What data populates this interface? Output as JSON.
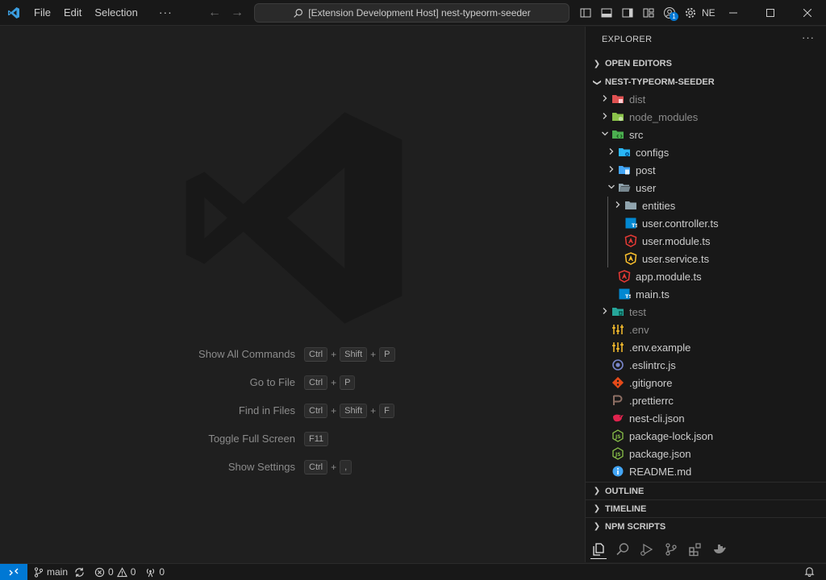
{
  "titlebar": {
    "menu": [
      "File",
      "Edit",
      "Selection"
    ],
    "more": "···",
    "command_center": "[Extension Development Host] nest-typeorm-seeder",
    "account_label": "NE",
    "account_badge": "1"
  },
  "shortcuts": [
    {
      "label": "Show All Commands",
      "keys": [
        "Ctrl",
        "Shift",
        "P"
      ]
    },
    {
      "label": "Go to File",
      "keys": [
        "Ctrl",
        "P"
      ]
    },
    {
      "label": "Find in Files",
      "keys": [
        "Ctrl",
        "Shift",
        "F"
      ]
    },
    {
      "label": "Toggle Full Screen",
      "keys": [
        "F11"
      ]
    },
    {
      "label": "Show Settings",
      "keys": [
        "Ctrl",
        ","
      ]
    }
  ],
  "explorer": {
    "title": "EXPLORER",
    "more": "···",
    "open_editors": "OPEN EDITORS",
    "project": "NEST-TYPEORM-SEEDER",
    "tree": [
      {
        "name": "dist",
        "depth": 0,
        "twist": "›",
        "icon": "folder-dist-icon",
        "color": "#e05252",
        "dim": true
      },
      {
        "name": "node_modules",
        "depth": 0,
        "twist": "›",
        "icon": "folder-node-icon",
        "color": "#8bc34a",
        "dim": true
      },
      {
        "name": "src",
        "depth": 0,
        "twist": "⌄",
        "icon": "folder-src-icon",
        "color": "#4caf50",
        "dim": false
      },
      {
        "name": "configs",
        "depth": 1,
        "twist": "›",
        "icon": "folder-config-icon",
        "color": "#29b6f6",
        "dim": false
      },
      {
        "name": "post",
        "depth": 1,
        "twist": "›",
        "icon": "folder-post-icon",
        "color": "#42a5f5",
        "dim": false
      },
      {
        "name": "user",
        "depth": 1,
        "twist": "⌄",
        "icon": "folder-open-icon",
        "color": "#90a4ae",
        "dim": false
      },
      {
        "name": "entities",
        "depth": 2,
        "twist": "›",
        "icon": "folder-icon",
        "color": "#90a4ae",
        "dim": false
      },
      {
        "name": "user.controller.ts",
        "depth": 2,
        "twist": "",
        "icon": "typescript-icon",
        "color": "#0288d1",
        "dim": false
      },
      {
        "name": "user.module.ts",
        "depth": 2,
        "twist": "",
        "icon": "angular-module-icon",
        "color": "#e53935",
        "dim": false
      },
      {
        "name": "user.service.ts",
        "depth": 2,
        "twist": "",
        "icon": "angular-service-icon",
        "color": "#fbc02d",
        "dim": false
      },
      {
        "name": "app.module.ts",
        "depth": 1,
        "twist": "",
        "icon": "angular-module-icon",
        "color": "#e53935",
        "dim": false
      },
      {
        "name": "main.ts",
        "depth": 1,
        "twist": "",
        "icon": "typescript-icon",
        "color": "#0288d1",
        "dim": false
      },
      {
        "name": "test",
        "depth": 0,
        "twist": "›",
        "icon": "folder-test-icon",
        "color": "#26a69a",
        "dim": true
      },
      {
        "name": ".env",
        "depth": 0,
        "twist": "",
        "icon": "env-icon",
        "color": "#fbc02d",
        "dim": true
      },
      {
        "name": ".env.example",
        "depth": 0,
        "twist": "",
        "icon": "env-icon",
        "color": "#fbc02d",
        "dim": false
      },
      {
        "name": ".eslintrc.js",
        "depth": 0,
        "twist": "",
        "icon": "eslint-icon",
        "color": "#7986cb",
        "dim": false
      },
      {
        "name": ".gitignore",
        "depth": 0,
        "twist": "",
        "icon": "git-icon",
        "color": "#e64a19",
        "dim": false
      },
      {
        "name": ".prettierrc",
        "depth": 0,
        "twist": "",
        "icon": "prettier-icon",
        "color": "#8d6e63",
        "dim": false
      },
      {
        "name": "nest-cli.json",
        "depth": 0,
        "twist": "",
        "icon": "nest-icon",
        "color": "#e0234e",
        "dim": false
      },
      {
        "name": "package-lock.json",
        "depth": 0,
        "twist": "",
        "icon": "nodejs-icon",
        "color": "#8bc34a",
        "dim": false
      },
      {
        "name": "package.json",
        "depth": 0,
        "twist": "",
        "icon": "nodejs-icon",
        "color": "#8bc34a",
        "dim": false
      },
      {
        "name": "README.md",
        "depth": 0,
        "twist": "",
        "icon": "info-icon",
        "color": "#42a5f5",
        "dim": false
      }
    ],
    "sections": [
      "OUTLINE",
      "TIMELINE",
      "NPM SCRIPTS"
    ]
  },
  "statusbar": {
    "branch": "main",
    "errors": "0",
    "warnings": "0",
    "ports": "0"
  }
}
